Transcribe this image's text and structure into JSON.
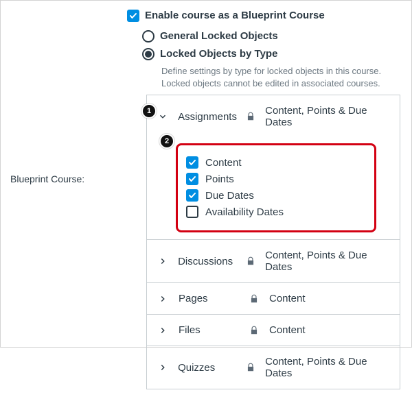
{
  "setting_label": "Blueprint Course:",
  "enable_label": "Enable course as a Blueprint Course",
  "enable_checked": true,
  "radios": {
    "general": {
      "label": "General Locked Objects",
      "selected": false
    },
    "by_type": {
      "label": "Locked Objects by Type",
      "selected": true
    }
  },
  "helper": "Define settings by type for locked objects in this course. Locked objects cannot be edited in associated courses.",
  "callouts": {
    "c1": "1",
    "c2": "2"
  },
  "types": [
    {
      "key": "assignments",
      "label": "Assignments",
      "summary": "Content, Points & Due Dates",
      "expanded": true,
      "options": [
        {
          "label": "Content",
          "checked": true
        },
        {
          "label": "Points",
          "checked": true
        },
        {
          "label": "Due Dates",
          "checked": true
        },
        {
          "label": "Availability Dates",
          "checked": false
        }
      ]
    },
    {
      "key": "discussions",
      "label": "Discussions",
      "summary": "Content, Points & Due Dates",
      "expanded": false
    },
    {
      "key": "pages",
      "label": "Pages",
      "summary": "Content",
      "expanded": false
    },
    {
      "key": "files",
      "label": "Files",
      "summary": "Content",
      "expanded": false
    },
    {
      "key": "quizzes",
      "label": "Quizzes",
      "summary": "Content, Points & Due Dates",
      "expanded": false
    }
  ]
}
